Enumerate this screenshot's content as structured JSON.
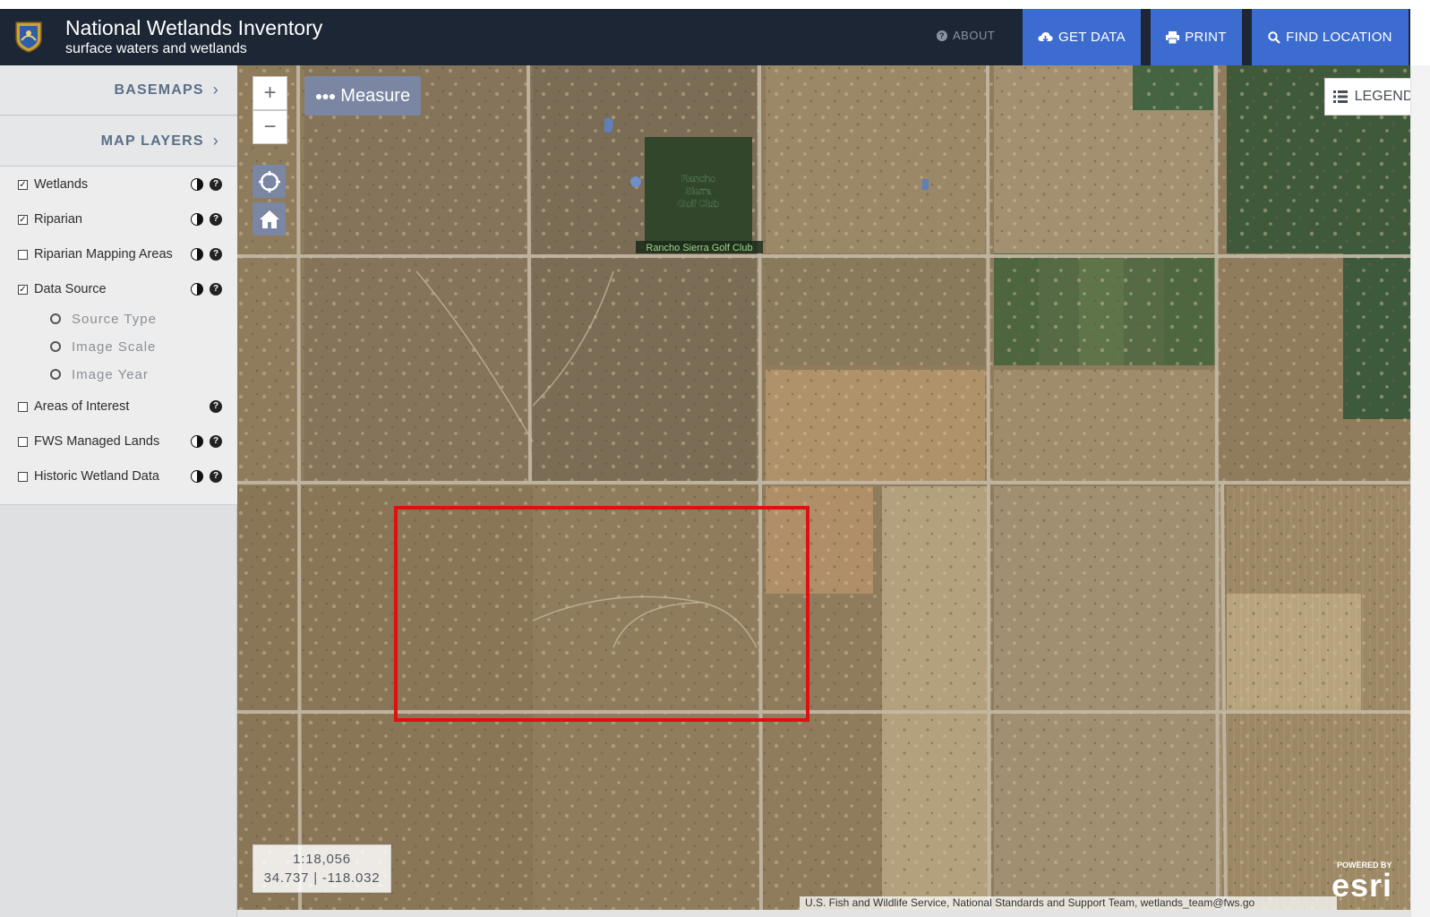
{
  "header": {
    "title": "National Wetlands Inventory",
    "subtitle": "surface waters and wetlands",
    "about_label": "ABOUT",
    "get_data_label": "GET DATA",
    "print_label": "PRINT",
    "find_location_label": "FIND LOCATION"
  },
  "sidebar": {
    "basemaps_label": "BASEMAPS",
    "map_layers_label": "MAP LAYERS",
    "layers": [
      {
        "label": "Wetlands",
        "checked": true
      },
      {
        "label": "Riparian",
        "checked": true
      },
      {
        "label": "Riparian Mapping Areas",
        "checked": false
      },
      {
        "label": "Data Source",
        "checked": true
      },
      {
        "label": "Areas of Interest",
        "checked": false
      },
      {
        "label": "FWS Managed Lands",
        "checked": false
      },
      {
        "label": "Historic Wetland Data",
        "checked": false
      }
    ],
    "data_source_options": [
      "Source Type",
      "Image Scale",
      "Image Year"
    ]
  },
  "map": {
    "measure_label": "Measure",
    "legend_label": "LEGEND",
    "zoom_in": "+",
    "zoom_out": "−",
    "scale": "1:18,056",
    "coordinates": "34.737 | -118.032",
    "place_label": "Rancho Sierra Golf Club",
    "place_label_stacked": "Rancho Sierra Golf Club",
    "attribution": "U.S. Fish and Wildlife Service, National Standards and Support Team, wetlands_team@fws.go",
    "esri_small": "POWERED BY",
    "esri_big": "esri",
    "highlight_color": "#e01010"
  },
  "colors": {
    "header_bg": "#1c2634",
    "nav_button": "#3c6ccf",
    "map_button": "#7b86a3"
  }
}
